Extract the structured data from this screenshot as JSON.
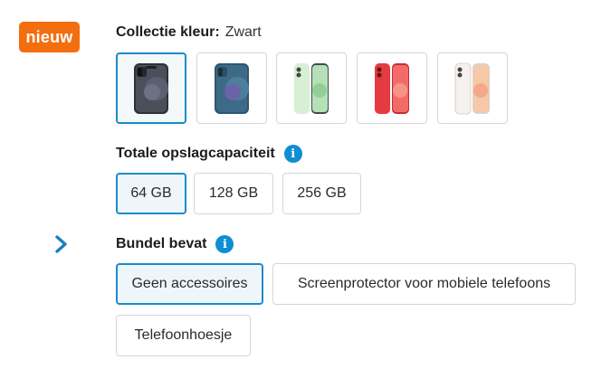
{
  "badge": {
    "label": "nieuw",
    "color": "#f36e0e"
  },
  "color_section": {
    "label": "Collectie kleur:",
    "selected_value": "Zwart",
    "swatches": [
      {
        "name": "Zwart",
        "color": "#3b3f48",
        "selected": true
      },
      {
        "name": "Blauw",
        "color": "#2f5670",
        "selected": false
      },
      {
        "name": "Groen",
        "color": "#c6e8c4",
        "selected": false
      },
      {
        "name": "Rood",
        "color": "#e53a3f",
        "selected": false
      },
      {
        "name": "Wit",
        "color": "#f4f1ee",
        "selected": false
      }
    ]
  },
  "storage_section": {
    "label": "Totale opslagcapaciteit",
    "info_icon": "info-icon",
    "options": [
      {
        "label": "64 GB",
        "selected": true
      },
      {
        "label": "128 GB",
        "selected": false
      },
      {
        "label": "256 GB",
        "selected": false
      }
    ]
  },
  "bundle_section": {
    "label": "Bundel bevat",
    "info_icon": "info-icon",
    "expand_icon": "chevron-right-icon",
    "options": [
      {
        "label": "Geen accessoires",
        "selected": true
      },
      {
        "label": "Screenprotector voor mobiele telefoons",
        "selected": false
      },
      {
        "label": "Telefoonhoesje",
        "selected": false
      }
    ]
  },
  "accent_color": "#1a8cc8",
  "info_color": "#0e8ed3"
}
